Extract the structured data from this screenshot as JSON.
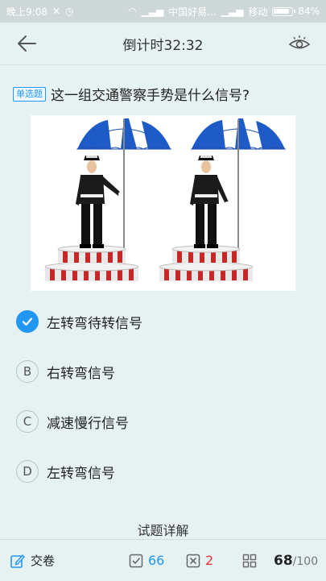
{
  "status_bar": {
    "time": "晚上9:08",
    "carrier_1": "中国好易...",
    "carrier_2": "移动",
    "battery": "84%"
  },
  "header": {
    "title": "倒计时32:32",
    "back_icon": "arrow-left-icon",
    "eye_icon": "eye-icon"
  },
  "question": {
    "type_badge": "单选题",
    "text": "这一组交通警察手势是什么信号?"
  },
  "options": [
    {
      "letter": "A",
      "label": "左转弯待转信号",
      "selected": true
    },
    {
      "letter": "B",
      "label": "右转弯信号",
      "selected": false
    },
    {
      "letter": "C",
      "label": "减速慢行信号",
      "selected": false
    },
    {
      "letter": "D",
      "label": "左转弯信号",
      "selected": false
    }
  ],
  "detail_link": "试题详解",
  "bottom_bar": {
    "submit_label": "交卷",
    "correct_count": "66",
    "wrong_count": "2",
    "progress_current": "68",
    "progress_total": "/100"
  },
  "colors": {
    "accent": "#2196f3",
    "wrong": "#e53935",
    "background": "#e6f2f2"
  }
}
